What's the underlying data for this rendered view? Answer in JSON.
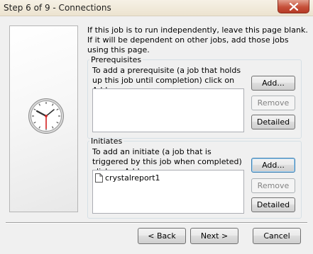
{
  "window": {
    "title": "Step 6 of 9 - Connections"
  },
  "intro_text": "If this job is to run independently, leave this page blank. If it will be dependent on other jobs, add those jobs using this page.",
  "prerequisites": {
    "legend": "Prerequisites",
    "description": "To add a prerequisite (a job that holds up this job until completion) click on Add...",
    "items": [],
    "add_label": "Add...",
    "remove_label": "Remove",
    "detailed_label": "Detailed"
  },
  "initiates": {
    "legend": "Initiates",
    "description": "To add an initiate (a job that is triggered by this job when completed) click on Add...",
    "items": [
      "crystalreport1"
    ],
    "add_label": "Add...",
    "remove_label": "Remove",
    "detailed_label": "Detailed"
  },
  "footer": {
    "back_label": "< Back",
    "next_label": "Next >",
    "cancel_label": "Cancel"
  },
  "icons": {
    "close": "close-icon",
    "wizard": "clock-icon",
    "list_item": "document-icon"
  },
  "colors": {
    "clock_hand_red": "#d42020",
    "close_button": "#c6503a"
  }
}
